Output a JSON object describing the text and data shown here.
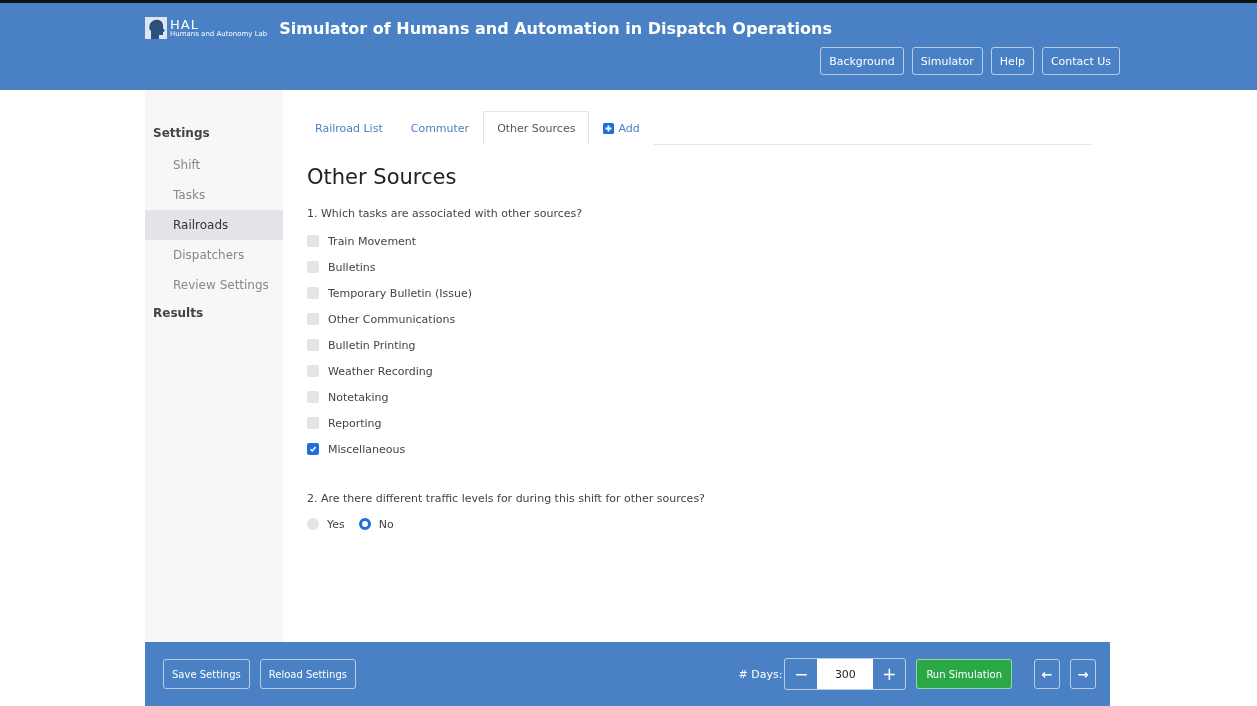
{
  "header": {
    "logo": {
      "name": "HAL",
      "subtitle": "Humans and Autonomy Lab"
    },
    "title": "Simulator of Humans and Automation in Dispatch Operations",
    "nav": [
      "Background",
      "Simulator",
      "Help",
      "Contact Us"
    ]
  },
  "sidebar": [
    {
      "label": "Settings",
      "items": [
        {
          "label": "Shift",
          "selected": false
        },
        {
          "label": "Tasks",
          "selected": false
        },
        {
          "label": "Railroads",
          "selected": true
        },
        {
          "label": "Dispatchers",
          "selected": false
        },
        {
          "label": "Review Settings",
          "selected": false
        }
      ]
    },
    {
      "label": "Results"
    }
  ],
  "tabs": [
    {
      "label": "Railroad List",
      "selected": false,
      "kind": "tab"
    },
    {
      "label": "Commuter",
      "selected": false,
      "kind": "tab"
    },
    {
      "label": "Other Sources",
      "selected": true,
      "kind": "tab"
    },
    {
      "label": "Add",
      "selected": false,
      "kind": "add"
    }
  ],
  "heading": "Other Sources",
  "question1": {
    "label": "1. Which tasks are associated with other sources?",
    "options": [
      {
        "label": "Train Movement",
        "checked": false
      },
      {
        "label": "Bulletins",
        "checked": false
      },
      {
        "label": "Temporary Bulletin (Issue)",
        "checked": false
      },
      {
        "label": "Other Communications",
        "checked": false
      },
      {
        "label": "Bulletin Printing",
        "checked": false
      },
      {
        "label": "Weather Recording",
        "checked": false
      },
      {
        "label": "Notetaking",
        "checked": false
      },
      {
        "label": "Reporting",
        "checked": false
      },
      {
        "label": "Miscellaneous",
        "checked": true
      }
    ]
  },
  "question2": {
    "label": "2. Are there different traffic levels for during this shift for other sources?",
    "options": [
      {
        "label": "Yes",
        "selected": false
      },
      {
        "label": "No",
        "selected": true
      }
    ]
  },
  "footer": {
    "buttons": [
      "Save Settings",
      "Reload Settings"
    ],
    "days_label": "# Days:",
    "minus": "−",
    "days": "300",
    "plus": "+",
    "run": "Run Simulation",
    "prev": "←",
    "next": "→"
  }
}
